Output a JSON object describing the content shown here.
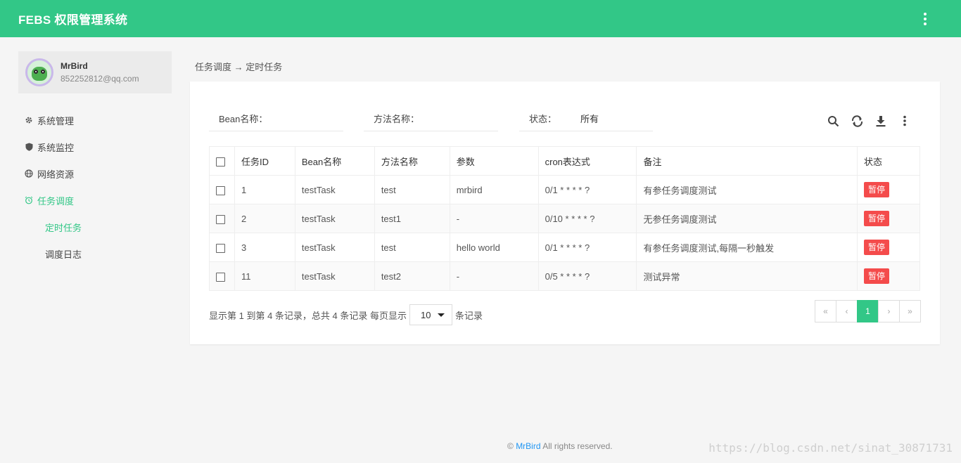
{
  "header": {
    "title": "FEBS 权限管理系统",
    "more_icon": "vertical-dots-icon"
  },
  "user": {
    "name": "MrBird",
    "email": "852252812@qq.com"
  },
  "sidebar": {
    "items": [
      {
        "label": "系统管理",
        "icon": "gear-icon"
      },
      {
        "label": "系统监控",
        "icon": "shield-icon"
      },
      {
        "label": "网络资源",
        "icon": "globe-icon"
      },
      {
        "label": "任务调度",
        "icon": "alarm-clock-icon"
      }
    ],
    "subitems": [
      {
        "label": "定时任务"
      },
      {
        "label": "调度日志"
      }
    ]
  },
  "breadcrumb": {
    "text": "任务调度 → 定时任务"
  },
  "filters": {
    "bean": {
      "label": "Bean名称：",
      "value": ""
    },
    "method": {
      "label": "方法名称：",
      "value": ""
    },
    "status": {
      "label": "状态：",
      "value": "所有"
    }
  },
  "table": {
    "headers": [
      "任务ID",
      "Bean名称",
      "方法名称",
      "参数",
      "cron表达式",
      "备注",
      "状态"
    ],
    "rows": [
      {
        "id": "1",
        "bean": "testTask",
        "method": "test",
        "params": "mrbird",
        "cron": "0/1 * * * * ?",
        "remark": "有参任务调度测试",
        "status": "暂停"
      },
      {
        "id": "2",
        "bean": "testTask",
        "method": "test1",
        "params": "-",
        "cron": "0/10 * * * * ?",
        "remark": "无参任务调度测试",
        "status": "暂停"
      },
      {
        "id": "3",
        "bean": "testTask",
        "method": "test",
        "params": "hello world",
        "cron": "0/1 * * * * ?",
        "remark": "有参任务调度测试,每隔一秒触发",
        "status": "暂停"
      },
      {
        "id": "11",
        "bean": "testTask",
        "method": "test2",
        "params": "-",
        "cron": "0/5 * * * * ?",
        "remark": "测试异常",
        "status": "暂停"
      }
    ]
  },
  "pagination": {
    "info_prefix": "显示第 1 到第 4 条记录，总共 4 条记录 每页显示",
    "page_size": "10",
    "info_suffix": "条记录",
    "first": "«",
    "prev": "‹",
    "current": "1",
    "next": "›",
    "last": "»"
  },
  "footer": {
    "prefix": "©",
    "link": "MrBird",
    "suffix": "All rights reserved."
  },
  "watermark": "https://blog.csdn.net/sinat_30871731",
  "colors": {
    "primary": "#32c787",
    "danger": "#f44b4b",
    "link": "#2196f3"
  }
}
